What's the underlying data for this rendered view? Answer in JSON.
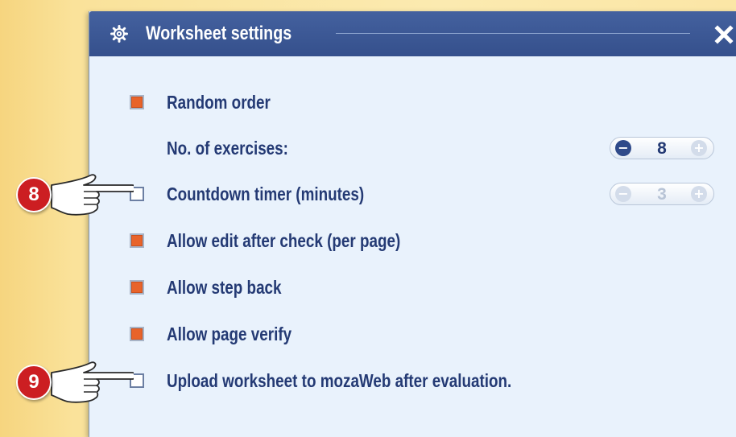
{
  "dialog": {
    "title": "Worksheet settings",
    "close_symbol": "✕",
    "icons": {
      "settings": "gear-icon",
      "close": "close-icon"
    }
  },
  "settings": {
    "random_order": {
      "label": "Random order",
      "checked": true
    },
    "exercises": {
      "label": "No. of exercises:",
      "value": "8",
      "enabled": true
    },
    "countdown_timer": {
      "label": "Countdown timer (minutes)",
      "checked": false,
      "value": "3",
      "enabled": false
    },
    "allow_edit": {
      "label": "Allow edit after check (per page)",
      "checked": true
    },
    "allow_step_back": {
      "label": "Allow step back",
      "checked": true
    },
    "allow_page_verify": {
      "label": "Allow page verify",
      "checked": true
    },
    "upload_worksheet": {
      "label": "Upload worksheet to mozaWeb after evaluation.",
      "checked": false
    }
  },
  "stepper": {
    "minus_symbol": "−",
    "plus_symbol": "+"
  },
  "callouts": [
    {
      "number": "8",
      "icon": "pointing-hand-icon"
    },
    {
      "number": "9",
      "icon": "pointing-hand-icon"
    }
  ],
  "colors": {
    "titlebar": "#3b5898",
    "dialog_bg": "#e9f2fc",
    "label": "#243a74",
    "checkbox_on": "#e8632a",
    "callout_badge": "#cc1e22",
    "page_bg": "#fbe6a6"
  }
}
